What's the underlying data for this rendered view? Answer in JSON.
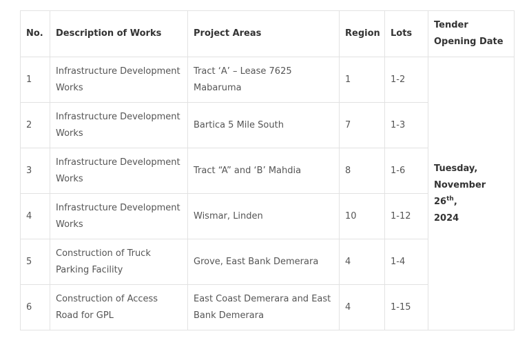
{
  "table": {
    "headers": [
      "No.",
      "Description of Works",
      "Project Areas",
      "Region",
      "Lots",
      "Tender Opening Date"
    ],
    "rows": [
      {
        "no": "1",
        "description": "Infrastructure Development Works",
        "area": "Tract ‘A’ – Lease 7625 Mabaruma",
        "region": "1",
        "lots": "1-2"
      },
      {
        "no": "2",
        "description": "Infrastructure Development Works",
        "area": "Bartica 5 Mile South",
        "region": "7",
        "lots": "1-3"
      },
      {
        "no": "3",
        "description": "Infrastructure Development Works",
        "area": "Tract “A” and ‘B’ Mahdia",
        "region": "8",
        "lots": "1-6"
      },
      {
        "no": "4",
        "description": "Infrastructure Development Works",
        "area": "Wismar, Linden",
        "region": "10",
        "lots": "1-12"
      },
      {
        "no": "5",
        "description": "Construction of Truck Parking Facility",
        "area": "Grove, East Bank Demerara",
        "region": "4",
        "lots": "1-4"
      },
      {
        "no": "6",
        "description": "Construction of Access Road for GPL",
        "area": "East Coast Demerara and East Bank Demerara",
        "region": "4",
        "lots": "1-15"
      }
    ],
    "opening_date": {
      "line1": "Tuesday,",
      "line2": "November 26",
      "suffix": "th",
      "tail": ",",
      "line3": "2024"
    }
  }
}
